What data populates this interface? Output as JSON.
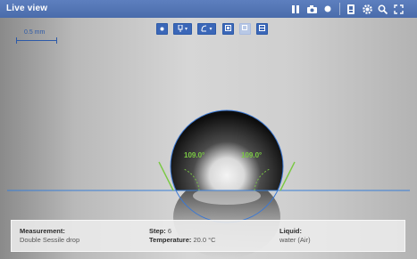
{
  "window": {
    "title": "Live view"
  },
  "scale_bar": {
    "label": "0.5 mm"
  },
  "angles": {
    "left": "109.0°",
    "right": "109.0°"
  },
  "info": {
    "measurement_label": "Measurement:",
    "measurement_value": "Double Sessile drop",
    "step_label": "Step:",
    "step_value": "6",
    "temperature_label": "Temperature:",
    "temperature_value": "20.0 °C",
    "liquid_label": "Liquid:",
    "liquid_value": "water (Air)"
  },
  "colors": {
    "accent": "#3b67b8",
    "baseline": "#3a7fd6",
    "fit_circle": "#3a78d4",
    "angle": "#7ac943"
  },
  "icons": {
    "titlebar": [
      "pause-icon",
      "camera-icon",
      "record-icon",
      "device-icon",
      "settings-icon",
      "zoom-icon",
      "fullscreen-icon"
    ],
    "toolbar": [
      "point-icon",
      "pipette-icon",
      "fit-icon",
      "crop-icon",
      "layers-icon",
      "overlay-icon"
    ]
  }
}
